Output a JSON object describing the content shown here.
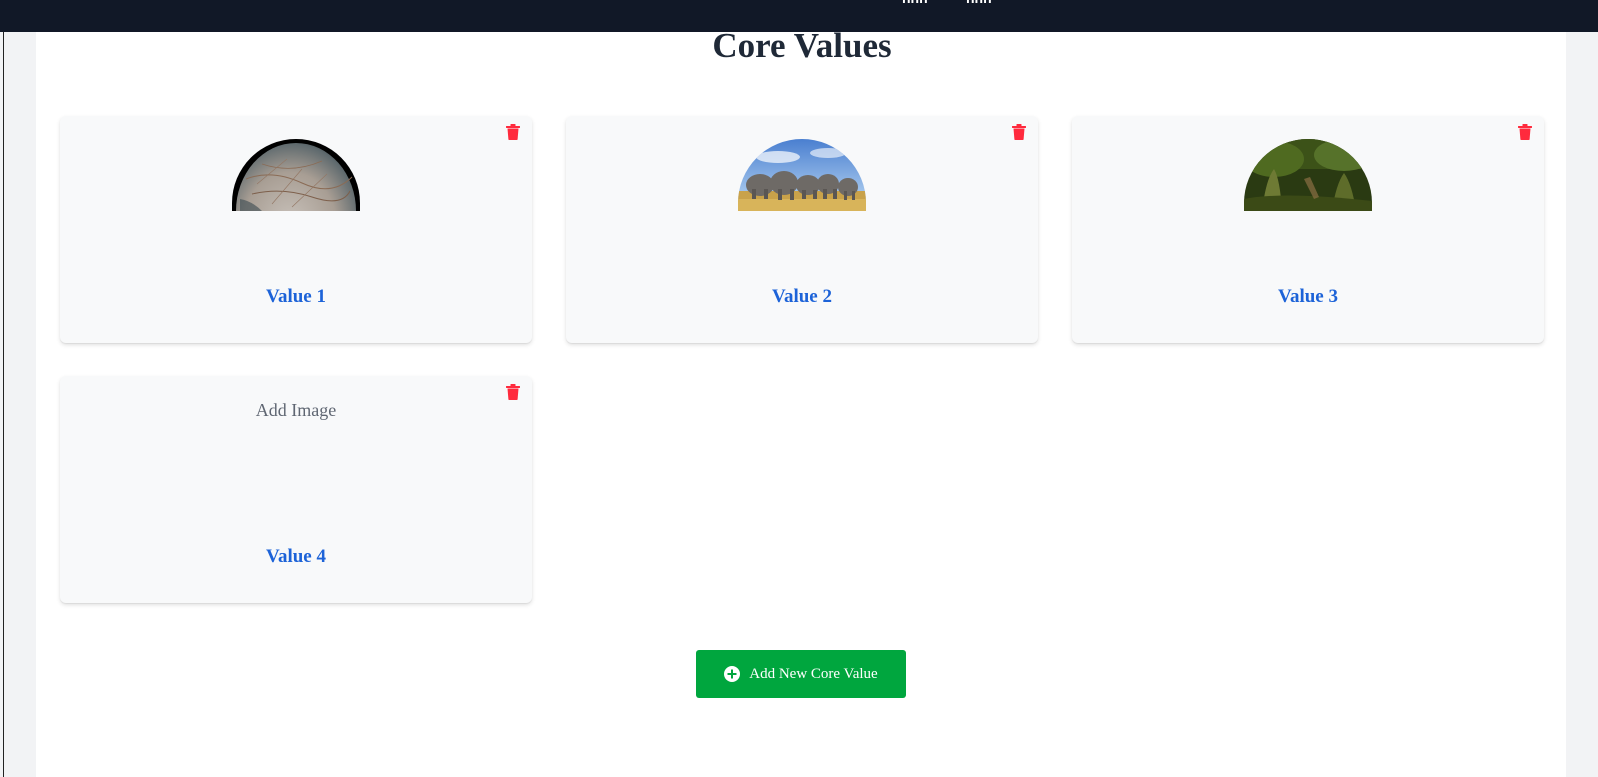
{
  "topbar": {
    "links": [
      "hhh",
      "hhh"
    ]
  },
  "page": {
    "title": "Core Values"
  },
  "cards": [
    {
      "label": "Value 1",
      "image": "europa-moon-photo"
    },
    {
      "label": "Value 2",
      "image": "elephant-herd-photo"
    },
    {
      "label": "Value 3",
      "image": "mossy-forest-photo"
    },
    {
      "label": "Value 4",
      "image": null,
      "placeholder": "Add Image"
    }
  ],
  "add_button": {
    "label": "Add New Core Value",
    "icon": "plus-circle-icon"
  },
  "colors": {
    "topbar": "#111827",
    "title": "#1f2937",
    "value_label": "#1d63d8",
    "delete_icon": "#ff2a3d",
    "add_button": "#00a63e"
  }
}
